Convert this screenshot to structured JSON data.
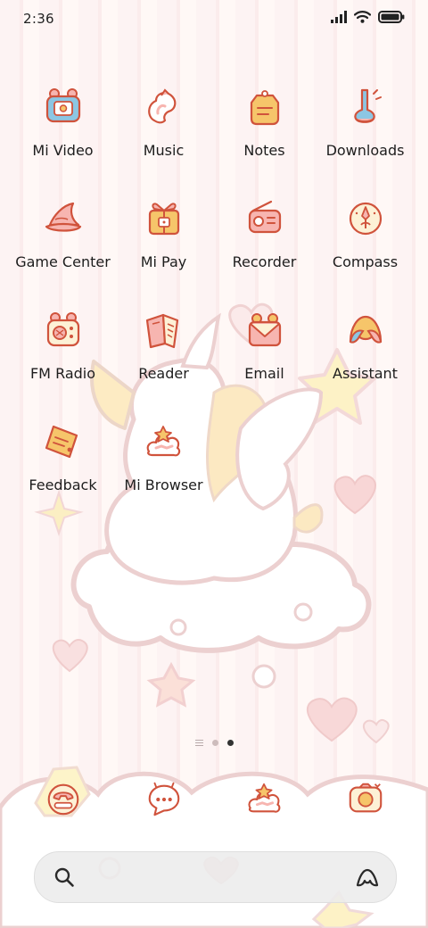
{
  "status": {
    "time": "2:36"
  },
  "apps": [
    {
      "label": "Mi Video",
      "icon": "mi-video-icon"
    },
    {
      "label": "Music",
      "icon": "music-icon"
    },
    {
      "label": "Notes",
      "icon": "notes-icon"
    },
    {
      "label": "Downloads",
      "icon": "downloads-icon"
    },
    {
      "label": "Game Center",
      "icon": "game-center-icon"
    },
    {
      "label": "Mi Pay",
      "icon": "mi-pay-icon"
    },
    {
      "label": "Recorder",
      "icon": "recorder-icon"
    },
    {
      "label": "Compass",
      "icon": "compass-icon"
    },
    {
      "label": "FM Radio",
      "icon": "fm-radio-icon"
    },
    {
      "label": "Reader",
      "icon": "reader-icon"
    },
    {
      "label": "Email",
      "icon": "email-icon"
    },
    {
      "label": "Assistant",
      "icon": "assistant-icon"
    },
    {
      "label": "Feedback",
      "icon": "feedback-icon"
    },
    {
      "label": "Mi Browser",
      "icon": "mi-browser-icon"
    }
  ],
  "dock": [
    {
      "icon": "phone-icon"
    },
    {
      "icon": "messaging-icon"
    },
    {
      "icon": "browser-icon"
    },
    {
      "icon": "camera-icon"
    }
  ],
  "pages": {
    "count": 2,
    "active": 2
  },
  "colors": {
    "outline": "#d0533c",
    "accent_yellow": "#f6c56a",
    "accent_pink": "#f7b5b0",
    "accent_blue": "#8cc6e3"
  }
}
